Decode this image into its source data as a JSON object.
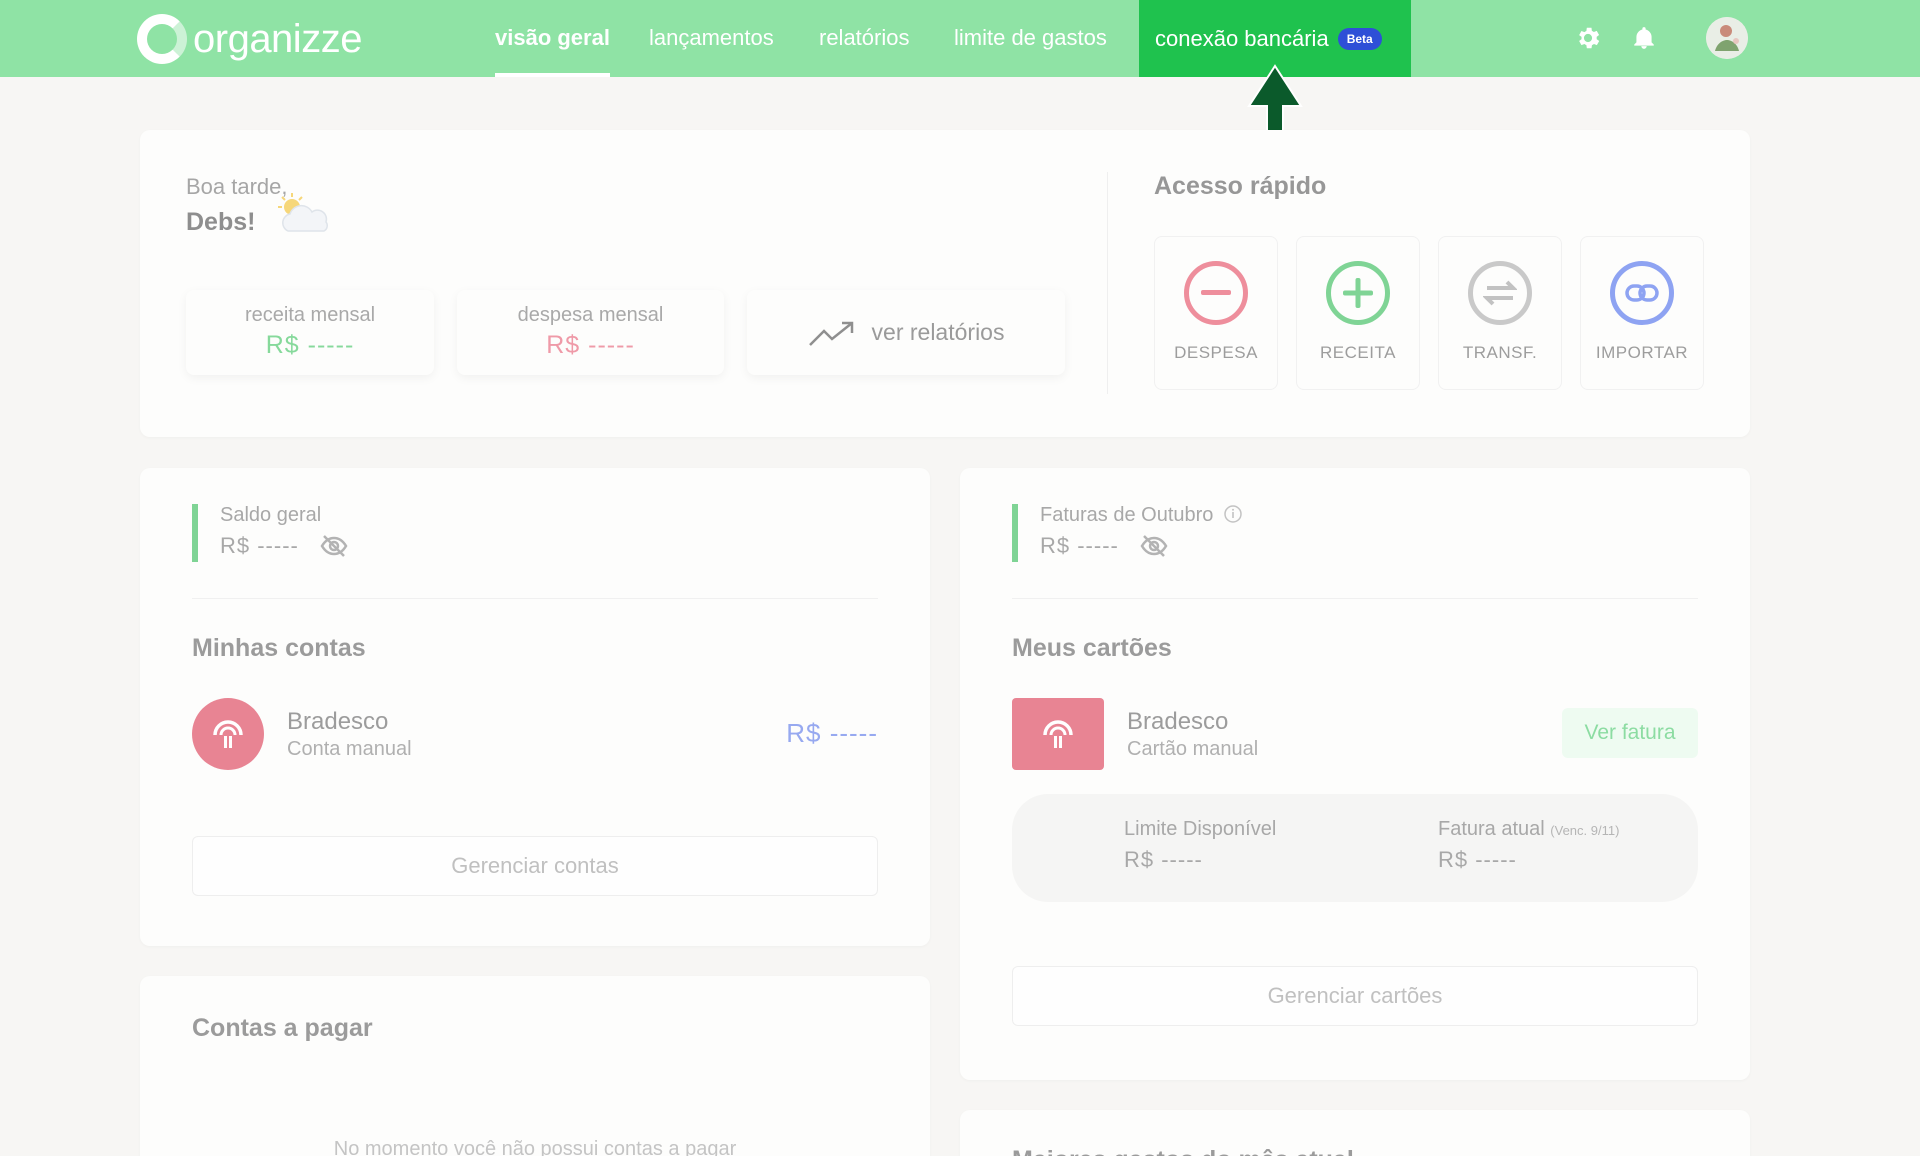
{
  "brand": {
    "name": "organizze"
  },
  "nav": {
    "items": [
      "visão geral",
      "lançamentos",
      "relatórios",
      "limite de gastos",
      "conexão bancária"
    ],
    "beta_badge": "Beta"
  },
  "greeting": {
    "line1": "Boa tarde,",
    "name": "Debs!"
  },
  "summary": {
    "income_label": "receita mensal",
    "income_value": "R$ -----",
    "expense_label": "despesa mensal",
    "expense_value": "R$ -----",
    "reports_link": "ver relatórios"
  },
  "quick_access": {
    "title": "Acesso rápido",
    "actions": [
      "DESPESA",
      "RECEITA",
      "TRANSF.",
      "IMPORTAR"
    ]
  },
  "accounts": {
    "balance_label": "Saldo geral",
    "balance_value": "R$ -----",
    "title": "Minhas contas",
    "bank_name": "Bradesco",
    "bank_type": "Conta manual",
    "bank_value": "R$ -----",
    "manage_button": "Gerenciar contas"
  },
  "cards": {
    "invoices_label": "Faturas de Outubro",
    "invoices_value": "R$ -----",
    "title": "Meus cartões",
    "card_name": "Bradesco",
    "card_type": "Cartão manual",
    "view_invoice": "Ver fatura",
    "limit_label": "Limite Disponível",
    "limit_value": "R$ -----",
    "current_invoice_label": "Fatura atual",
    "current_invoice_due": "(Venc. 9/11)",
    "current_invoice_value": "R$ -----",
    "manage_button": "Gerenciar cartões"
  },
  "payables": {
    "title": "Contas a pagar",
    "empty_message": "No momento você não possui contas a pagar"
  },
  "biggest_expenses": {
    "title": "Maiores gastos do mês atual"
  },
  "colors": {
    "topbar": "#8fe3a5",
    "nav_highlight": "#1fc24e",
    "beta": "#2e4fd7",
    "income": "#86d99b",
    "expense": "#ef9aa8",
    "bank": "#e88493",
    "arrow": "#0b5a2b"
  }
}
